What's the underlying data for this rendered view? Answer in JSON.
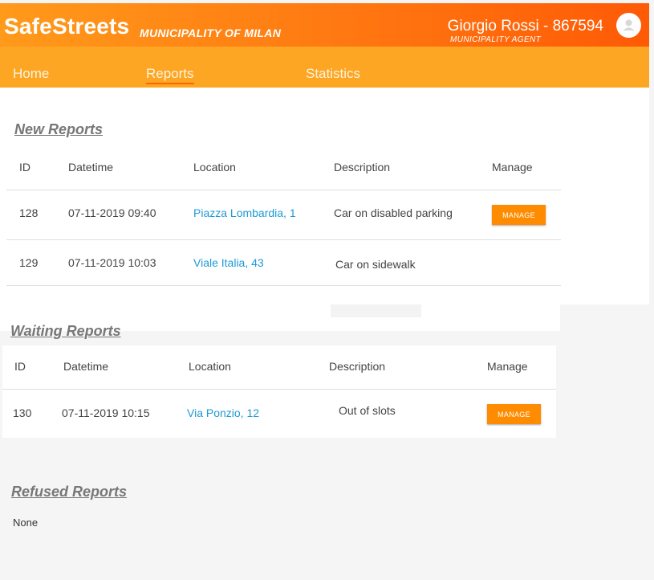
{
  "header": {
    "brand": "SafeStreets",
    "municipality": "MUNICIPALITY OF MILAN",
    "user_name": "Giorgio Rossi - 867594",
    "user_role": "MUNICIPALITY AGENT",
    "avatar_icon": "user-avatar-icon"
  },
  "nav": {
    "items": [
      {
        "label": "Home",
        "active": false
      },
      {
        "label": "Reports",
        "active": true
      },
      {
        "label": "Statistics",
        "active": false
      }
    ]
  },
  "new_reports": {
    "title": "New Reports",
    "columns": [
      "ID",
      "Datetime",
      "Location",
      "Description",
      "Manage"
    ],
    "rows": [
      {
        "id": "128",
        "datetime": "07-11-2019 09:40",
        "location": "Piazza Lombardia, 1",
        "description": "Car on disabled parking",
        "manage": "MANAGE"
      },
      {
        "id": "129",
        "datetime": "07-11-2019 10:03",
        "location": "Viale Italia, 43",
        "description": "Car on sidewalk",
        "manage": ""
      }
    ]
  },
  "waiting_reports": {
    "title": "Waiting Reports",
    "columns": [
      "ID",
      "Datetime",
      "Location",
      "Description",
      "Manage"
    ],
    "rows": [
      {
        "id": "130",
        "datetime": "07-11-2019 10:15",
        "location": "Via Ponzio, 12",
        "description": "Out of slots",
        "manage": "MANAGE"
      }
    ]
  },
  "refused_reports": {
    "title": "Refused Reports",
    "empty_text": "None"
  },
  "colors": {
    "accent": "#ff8c00",
    "navbar": "#fca624",
    "link": "#1e9ad6"
  }
}
